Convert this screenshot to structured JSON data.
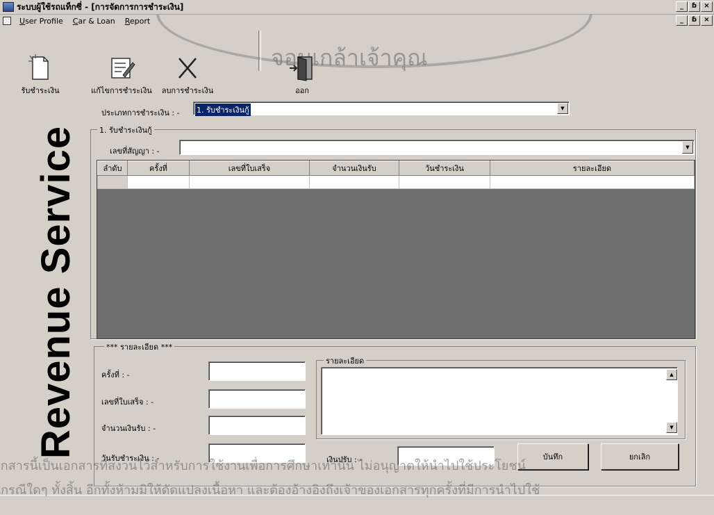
{
  "window": {
    "title": "ระบบผู้ใช้รถแท็กซี่ - [การจัดการการชำระเงิน]",
    "controls": [
      "_",
      "ɓ",
      "×"
    ]
  },
  "menu": {
    "items": [
      {
        "acc": "U",
        "rest": "ser Profile"
      },
      {
        "acc": "C",
        "rest": "ar & Loan"
      },
      {
        "acc": "R",
        "rest": "eport"
      }
    ]
  },
  "toolbar": {
    "receive_label": "รับชำระเงิน",
    "edit_label": "แก้ไขการชำระเงิน",
    "delete_label": "ลบการชำระเงิน",
    "exit_label": "ออก"
  },
  "banner": {
    "text": "Revenue Service"
  },
  "form": {
    "payment_type_label": "ประเภทการชำระเงิน : -",
    "payment_type_value": "1. รับชำระเงินกู้",
    "group_title": "1. รับชำระเงินกู้",
    "contract_label": "เลขที่สัญญา : -",
    "contract_value": ""
  },
  "grid": {
    "columns": [
      "ลำดับ",
      "ครั้งที่",
      "เลขที่ใบเสร็จ",
      "จำนวนเงินรับ",
      "วันชำระเงิน",
      "รายละเอียด"
    ],
    "rows": [
      [
        "",
        "",
        "",
        "",
        "",
        ""
      ]
    ]
  },
  "details": {
    "group_title": "*** รายละเอียด ***",
    "installment_label": "ครั้งที่ : -",
    "receipt_label": "เลขที่ใบเสร็จ : -",
    "amount_label": "จำนวนเงินรับ : -",
    "date_label": "วันรับชำระเงิน : -",
    "note_title": "รายละเอียด",
    "fine_label": "เงินปรับ : -",
    "save_label": "บันทึก",
    "cancel_label": "ยกเลิก"
  },
  "watermark": {
    "seal_text": "จอมเกล้าเจ้าคุณ",
    "line1": "อกสารนี้เป็นเอกสารที่สงวนไว้สำหรับการใช้งานเพื่อการศึกษาเท่านั้น ไม่อนุญาตให้นำไปใช้ประโยชน์",
    "line2": "ในกรณีใดๆ ทั้งสิ้น อีกทั้งห้ามมิให้ดัดแปลงเนื้อหา และต้องอ้างอิงถึงเจ้าของเอกสารทุกครั้งที่มีการนำไปใช้"
  }
}
